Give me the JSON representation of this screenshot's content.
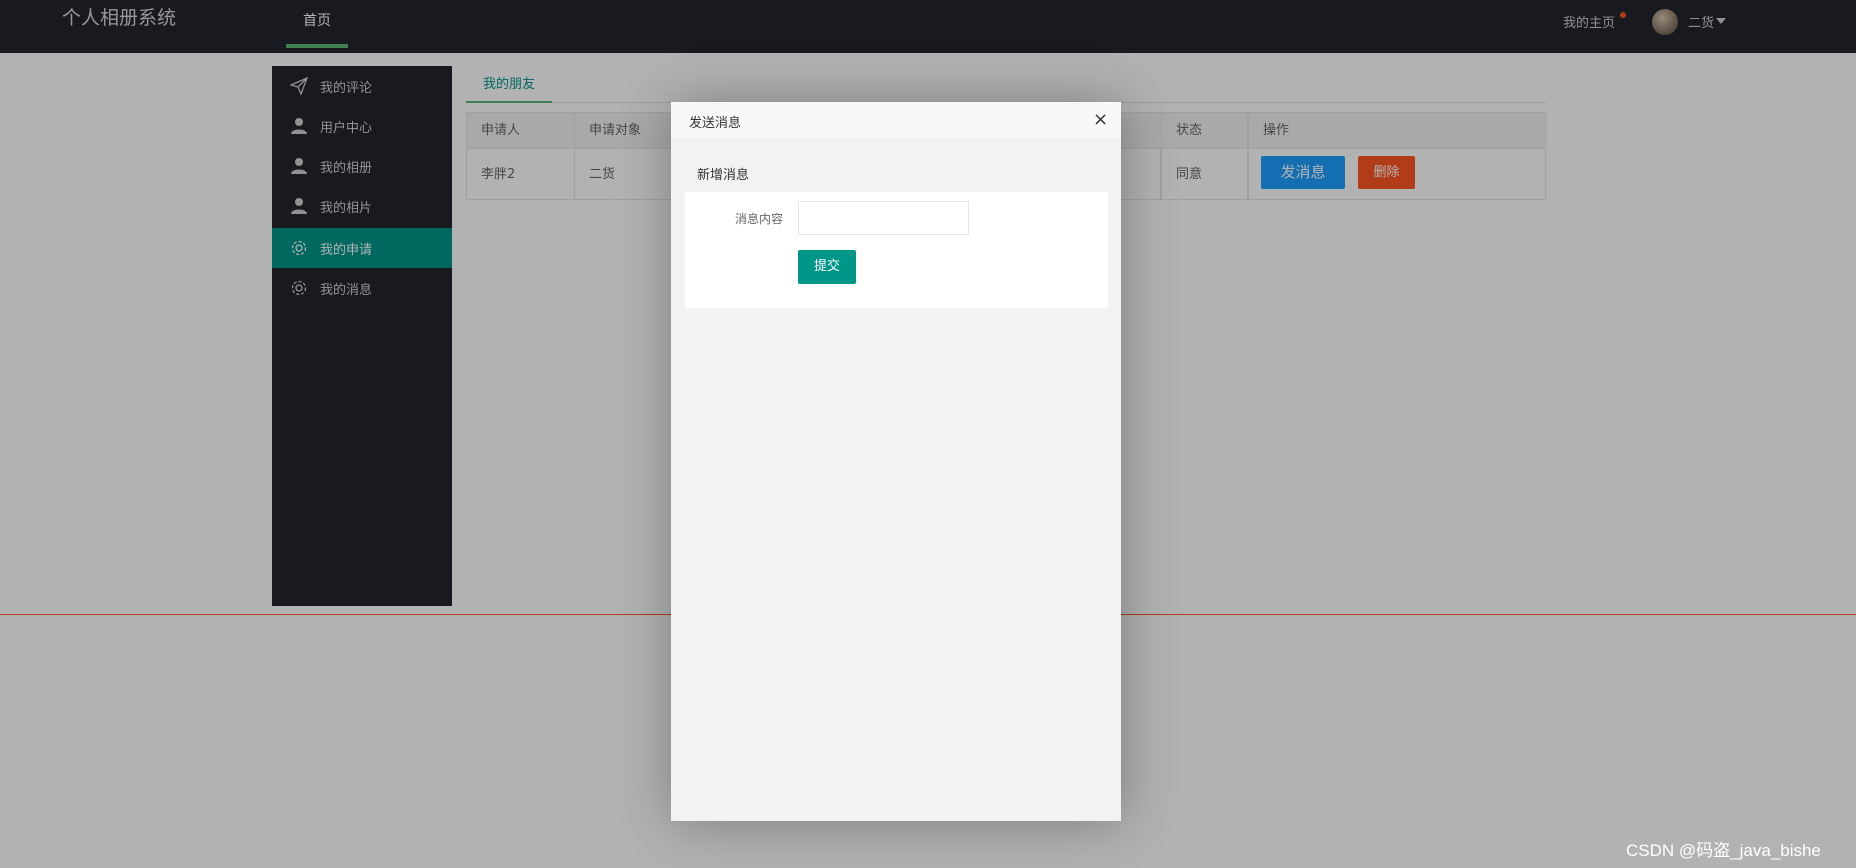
{
  "header": {
    "logo": "个人相册系统",
    "nav_home": "首页",
    "my_home": "我的主页",
    "username": "二货"
  },
  "sidebar": {
    "items": [
      {
        "label": "我的评论",
        "icon": "paper-plane-icon"
      },
      {
        "label": "用户中心",
        "icon": "user-icon"
      },
      {
        "label": "我的相册",
        "icon": "user-icon"
      },
      {
        "label": "我的相片",
        "icon": "user-icon"
      },
      {
        "label": "我的申请",
        "icon": "gear-icon",
        "active": true
      },
      {
        "label": "我的消息",
        "icon": "gear-icon"
      }
    ]
  },
  "tabs": {
    "active": "我的朋友"
  },
  "table": {
    "headers": [
      "申请人",
      "申请对象",
      "状态",
      "操作"
    ],
    "rows": [
      {
        "applicant": "李胖2",
        "target": "二货",
        "status": "同意",
        "send_label": "发消息",
        "delete_label": "删除"
      }
    ]
  },
  "modal": {
    "title": "发送消息",
    "close": "×",
    "section_title": "新增消息",
    "field_label": "消息内容",
    "field_value": "",
    "submit_label": "提交"
  },
  "watermark": "CSDN @码盗_java_bishe",
  "colors": {
    "header_bg": "#23262e",
    "accent": "#009688",
    "blue": "#1e9fff",
    "orange": "#ff5722",
    "nav_indicator": "#5fb878"
  }
}
